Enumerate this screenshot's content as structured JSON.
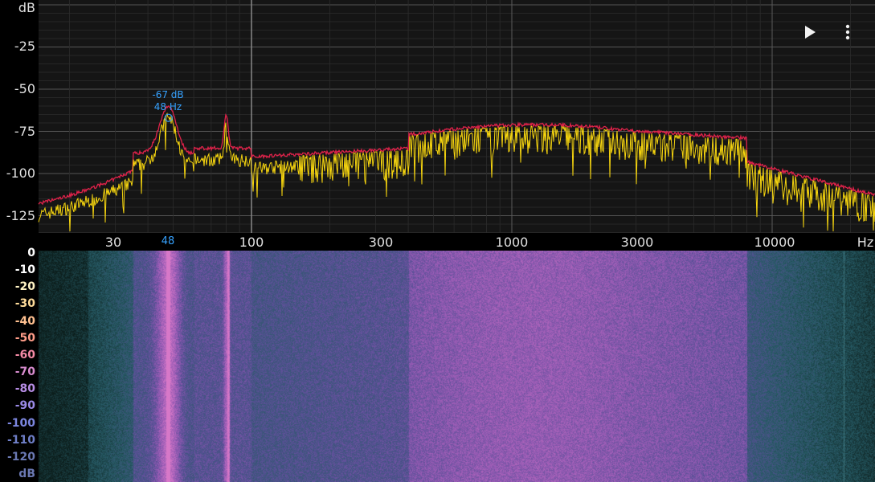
{
  "spectrum": {
    "y_unit": "dB",
    "x_unit": "Hz",
    "y_ticks": [
      "-25",
      "-50",
      "-75",
      "-100",
      "-125"
    ],
    "x_ticks": [
      "30",
      "48",
      "100",
      "300",
      "1000",
      "3000",
      "10000"
    ],
    "peak": {
      "db_label": "-67 dB",
      "hz_label": "48 Hz",
      "freq_hz": 48,
      "db": -67
    },
    "colors": {
      "live_trace": "#f5d40f",
      "peak_hold_trace": "#e0224a",
      "peak_marker": "#36a2ff",
      "grid": "#3a3a3a"
    }
  },
  "controls": {
    "play_icon": "play-icon",
    "menu_icon": "more-vert-icon"
  },
  "spectrogram": {
    "scale_unit": "dB",
    "scale_ticks": [
      "0",
      "-10",
      "-20",
      "-30",
      "-40",
      "-50",
      "-60",
      "-70",
      "-80",
      "-90",
      "-100",
      "-110",
      "-120"
    ],
    "scale_colors": [
      "#ffffff",
      "#ffffff",
      "#fff3c4",
      "#ffdc9a",
      "#ffc090",
      "#ff9c88",
      "#f48aa5",
      "#d88ccf",
      "#b68ce4",
      "#9a8ae6",
      "#7b86df",
      "#6f7fc8",
      "#6a78b2"
    ]
  }
}
